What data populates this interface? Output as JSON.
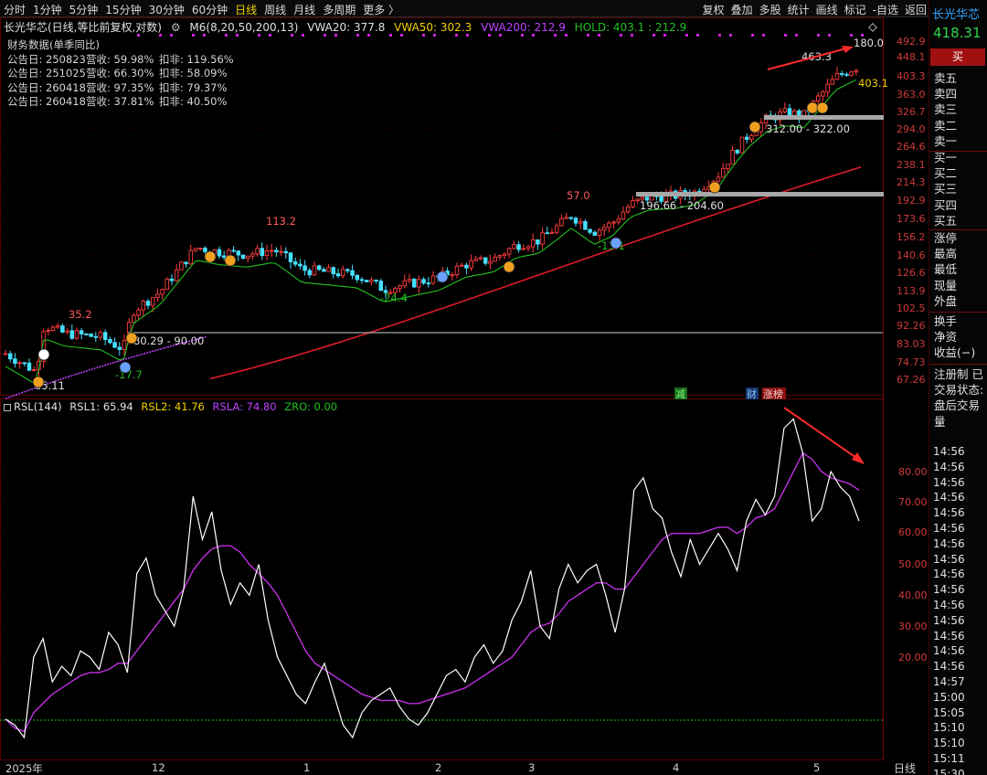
{
  "toolbar": {
    "periods": [
      "分时",
      "1分钟",
      "5分钟",
      "15分钟",
      "30分钟",
      "60分钟",
      "日线",
      "周线",
      "月线",
      "多周期",
      "更多 〉"
    ],
    "active_period": "日线",
    "tools": [
      "复权",
      "叠加",
      "多股",
      "统计",
      "画线",
      "标记",
      "-自选",
      "返回"
    ]
  },
  "title": {
    "stock": "长光华芯(日线,等比前复权,对数)",
    "indicator": "M6(8,20,50,200,13)",
    "vwa20": "VWA20: 377.8",
    "vwa50": "VWA50: 302.3",
    "vwa200": "VWA200: 212.9",
    "hold": "HOLD: 403.1 : 212.9"
  },
  "finance": {
    "title": "财务数据(单季同比)",
    "rows": [
      {
        "date": "公告日: 250823",
        "rev": "营收: 59.98%",
        "net": "扣非: 119.56%"
      },
      {
        "date": "公告日: 251025",
        "rev": "营收: 66.30%",
        "net": "扣非: 58.09%"
      },
      {
        "date": "公告日: 260418",
        "rev": "营收: 97.35%",
        "net": "扣非: 79.37%"
      },
      {
        "date": "公告日: 260418",
        "rev": "营收: 37.81%",
        "net": "扣非: 40.50%"
      }
    ]
  },
  "price_axis": [
    "492.9",
    "448.1",
    "403.3",
    "363.0",
    "326.7",
    "294.0",
    "264.6",
    "238.1",
    "214.3",
    "192.9",
    "173.6",
    "156.2",
    "140.6",
    "126.6",
    "113.9",
    "102.5",
    "92.26",
    "83.03",
    "74.73",
    "67.26"
  ],
  "annotations": {
    "high1": "35.2",
    "low1": "65.11",
    "low_pct1": "-17.7",
    "zone1": "80.29 - 90.00",
    "high2": "113.2",
    "low2": "-24.4",
    "high3": "57.0",
    "low3": "-13.1",
    "zone2": "196.66 - 204.60",
    "zone3": "312.00 - 322.00",
    "high4": "463.3",
    "top_pct": "180.0",
    "hold_val": "403.1",
    "tag_jian": "减",
    "tag_cai": "财",
    "tag_zhangting": "涨榜"
  },
  "rsl": {
    "name": "RSL(144)",
    "rsl1": "RSL1: 65.94",
    "rsl2": "RSL2: 41.76",
    "rsla": "RSLA: 74.80",
    "zro": "ZRO: 0.00",
    "axis": [
      "80.00",
      "70.00",
      "60.00",
      "50.00",
      "40.00",
      "30.00",
      "20.00"
    ]
  },
  "date_axis": {
    "labels": [
      "2025年",
      "12",
      "1",
      "2",
      "3",
      "4",
      "5"
    ],
    "period": "日线"
  },
  "right_panel": {
    "name": "长光华芯",
    "price": "418.31",
    "buy": "买",
    "sell_levels": [
      "卖五",
      "卖四",
      "卖三",
      "卖二",
      "卖一"
    ],
    "buy_levels": [
      "买一",
      "买二",
      "买三",
      "买四",
      "买五"
    ],
    "stats": [
      "涨停",
      "最高",
      "最低",
      "现量",
      "外盘"
    ],
    "stats2": [
      "换手",
      "净资",
      "收益(−)"
    ],
    "status": [
      "注册制 已",
      "交易状态:",
      "盘后交易量"
    ],
    "times": [
      "14:56",
      "14:56",
      "14:56",
      "14:56",
      "14:56",
      "14:56",
      "14:56",
      "14:56",
      "14:56",
      "14:56",
      "14:56",
      "14:56",
      "14:56",
      "14:56",
      "14:56",
      "14:57",
      "15:00",
      "15:05",
      "15:10",
      "15:10",
      "15:11",
      "15:30"
    ]
  },
  "colors": {
    "up": "#ff3d3d",
    "down": "#45e0ff",
    "ma_green": "#22c022",
    "vwa200": "#e01a2a",
    "vwa_magenta": "#c040ff",
    "rsl2": "#c030e0",
    "yellow": "#f0d000"
  }
}
